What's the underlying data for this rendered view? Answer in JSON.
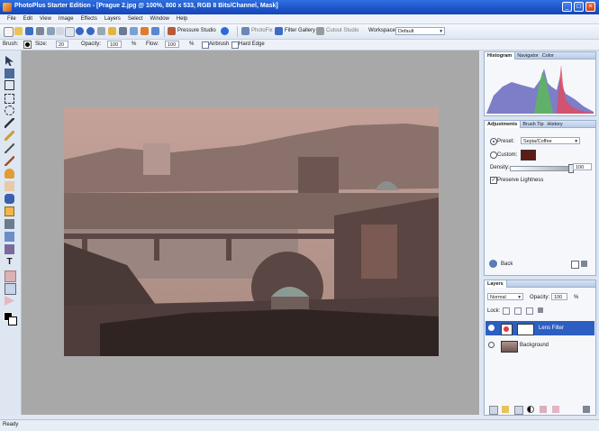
{
  "window": {
    "title": "PhotoPlus Starter Edition - [Prague 2.jpg @ 100%, 800 x 533, RGB 8 Bits/Channel, Mask]"
  },
  "menu": [
    "File",
    "Edit",
    "View",
    "Image",
    "Effects",
    "Layers",
    "Select",
    "Window",
    "Help"
  ],
  "toolbar": {
    "pressure_studio": "Pressure Studio",
    "photofix": "PhotoFix",
    "filter_gallery": "Filter Gallery",
    "cutout_studio": "Cutout Studio",
    "workspace_label": "Workspace:",
    "workspace_value": "Default"
  },
  "context_bar": {
    "brush_label": "Brush:",
    "size_label": "Size:",
    "size_value": "20",
    "opacity_label": "Opacity:",
    "opacity_value": "100",
    "opacity_unit": "%",
    "flow_label": "Flow:",
    "flow_value": "100",
    "flow_unit": "%",
    "airbrush": "Airbrush",
    "hard_edge": "Hard Edge"
  },
  "panels": {
    "histogram": {
      "tabs": [
        "Histogram",
        "Navigator",
        "Color"
      ]
    },
    "adjustments": {
      "tabs": [
        "Adjustments",
        "Brush Tip",
        "History"
      ],
      "preset_label": "Preset:",
      "preset_value": "Sepia/Coffee",
      "custom_label": "Custom:",
      "custom_color": "#5a1e16",
      "density_label": "Density:",
      "density_value": "100",
      "preserve_lightness": "Preserve Lightness",
      "back_label": "Back"
    },
    "layers": {
      "title": "Layers",
      "blend_mode": "Normal",
      "opacity_label": "Opacity:",
      "opacity_value": "100",
      "opacity_unit": "%",
      "lock_label": "Lock:",
      "items": [
        {
          "name": "Lens Filter",
          "selected": true
        },
        {
          "name": "Background",
          "selected": false
        }
      ]
    }
  },
  "status": {
    "text": "Ready"
  }
}
